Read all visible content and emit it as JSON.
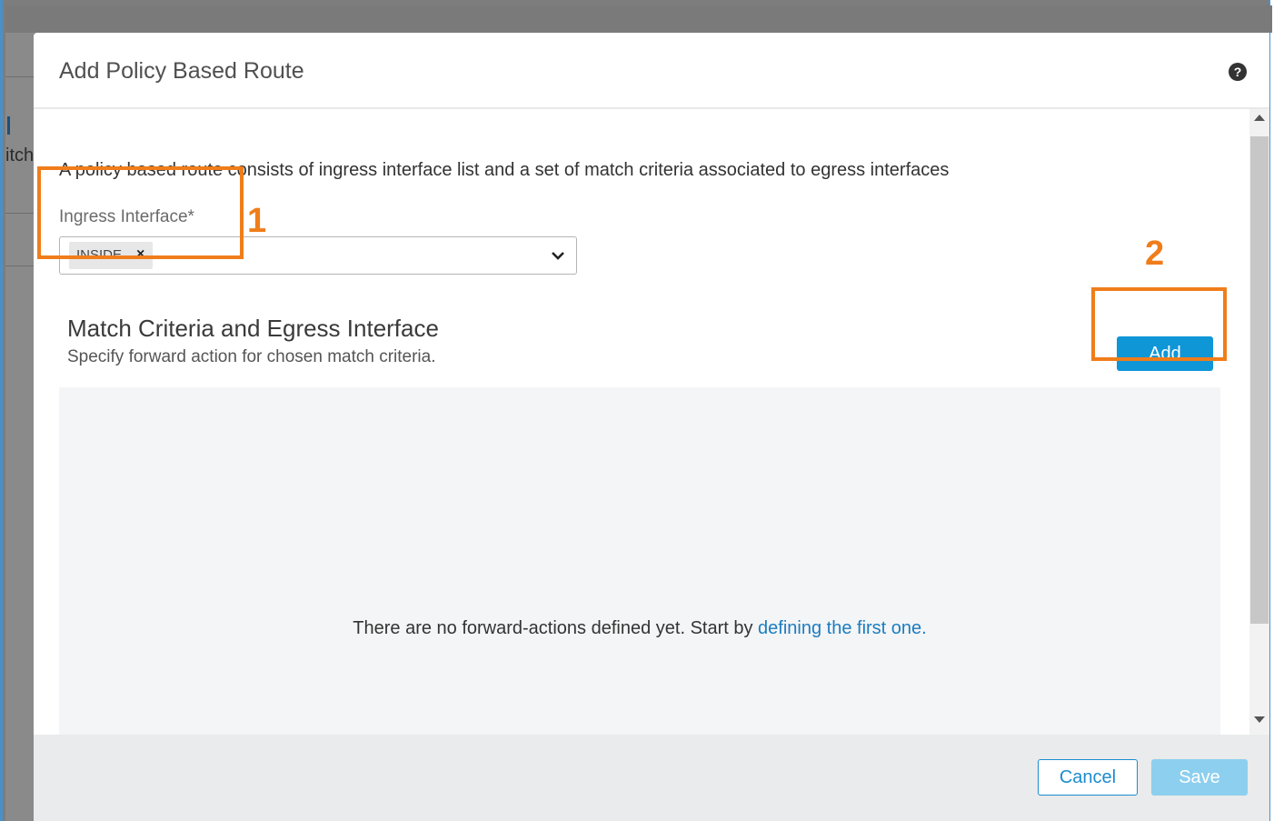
{
  "background": {
    "partial_text": "itch"
  },
  "modal": {
    "title": "Add Policy Based Route",
    "help_icon": "?",
    "description": "A policy based route consists of ingress interface list and a set of match criteria associated to egress interfaces",
    "ingress": {
      "label": "Ingress Interface*",
      "selected_chip": "INSIDE",
      "chip_remove": "×"
    },
    "section": {
      "title": "Match Criteria and Egress Interface",
      "subtitle": "Specify forward action for chosen match criteria.",
      "add_label": "Add"
    },
    "empty_state": {
      "message": "There are no forward-actions defined yet. Start by ",
      "link": "defining the first one",
      "trailing": "."
    },
    "footer": {
      "cancel_label": "Cancel",
      "save_label": "Save"
    }
  },
  "annotations": {
    "one": "1",
    "two": "2"
  },
  "colors": {
    "accent": "#0f96d7",
    "annotation": "#f07d1a",
    "link": "#1c7cc0",
    "save_disabled": "#8dcfee"
  }
}
